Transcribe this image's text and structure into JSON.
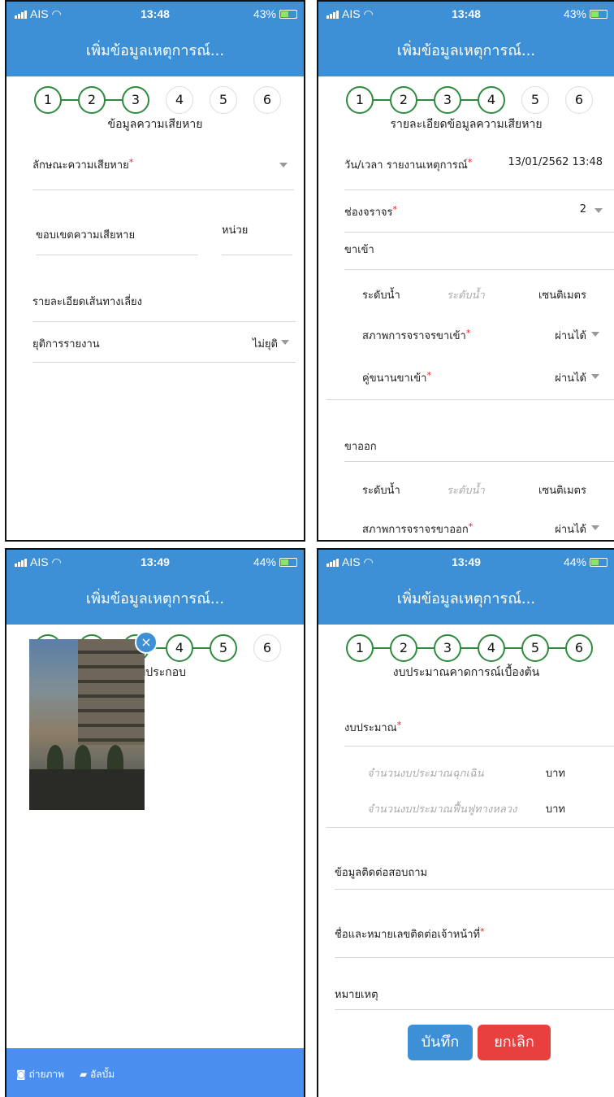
{
  "status": {
    "carrier": "AIS",
    "screens": [
      {
        "time": "13:48",
        "battery": "43%"
      },
      {
        "time": "13:48",
        "battery": "43%"
      },
      {
        "time": "13:49",
        "battery": "44%"
      },
      {
        "time": "13:49",
        "battery": "44%"
      }
    ]
  },
  "app_title": "เพิ่มข้อมูลเหตุการณ์...",
  "steps": [
    "1",
    "2",
    "3",
    "4",
    "5",
    "6"
  ],
  "screen1": {
    "step_title": "ข้อมูลความเสียหาย",
    "damage_type_label": "ลักษณะความเสียหาย",
    "scope_label": "ขอบเขตความเสียหาย",
    "unit_label": "หน่วย",
    "detour_label": "รายละเอียดเส้นทางเลี่ยง",
    "end_report_label": "ยุติการรายงาน",
    "end_report_value": "ไม่ยุติ"
  },
  "screen2": {
    "step_title": "รายละเอียดข้อมูลความเสียหาย",
    "report_time_label": "วัน/เวลา รายงานเหตุการณ์",
    "report_time_value": "13/01/2562 13:48",
    "lanes_label": "ช่องจราจร",
    "lanes_value": "2",
    "inbound_label": "ขาเข้า",
    "water_label": "ระดับน้ำ",
    "water_placeholder": "ระดับน้ำ",
    "water_unit": "เซนติเมตร",
    "inbound_traffic_label": "สภาพการจราจรขาเข้า",
    "pass_value": "ผ่านได้",
    "inbound_parallel_label": "คู่ขนานขาเข้า",
    "outbound_label": "ขาออก",
    "outbound_traffic_label": "สภาพการจราจรขาออก"
  },
  "screen3": {
    "step_title": "ภาพประกอบ",
    "camera_label": "ถ่ายภาพ",
    "album_label": "อัลบั้ม"
  },
  "screen4": {
    "step_title": "งบประมาณคาดการณ์เบื้องต้น",
    "budget_label": "งบประมาณ",
    "emergency_placeholder": "จำนวนงบประมาณฉุกเฉิน",
    "recovery_placeholder": "จำนวนงบประมาณฟื้นฟูทางหลวง",
    "currency": "บาท",
    "contact_header": "ข้อมูลติดต่อสอบถาม",
    "contact_label": "ชื่อและหมายเลขติดต่อเจ้าหน้าที่",
    "note_label": "หมายเหตุ",
    "save_label": "บันทึก",
    "cancel_label": "ยกเลิก"
  },
  "colors": {
    "header": "#3d8fd6",
    "step_done": "#2e8b3e",
    "save": "#3d8fd6",
    "cancel": "#e8403f",
    "required": "#e02020"
  }
}
